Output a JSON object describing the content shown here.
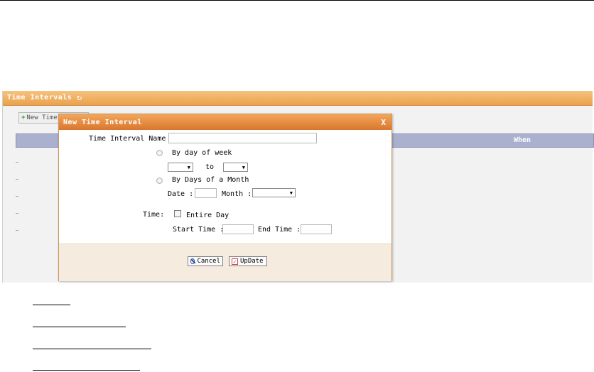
{
  "panel": {
    "title": "Time Intervals",
    "new_button_label": "New Time",
    "grid_column_when": "When"
  },
  "dialog": {
    "title": "New Time Interval",
    "close_label": "X",
    "name_label": "Time Interval Name :",
    "name_value": "",
    "by_day_of_week_label": "By day of week",
    "to_label": "to",
    "by_days_of_month_label": "By Days of a Month",
    "date_label": "Date :",
    "month_label": "Month :",
    "time_label": "Time:",
    "entire_day_label": "Entire Day",
    "start_time_label": "Start Time :",
    "end_time_label": "End Time :",
    "cancel_label": "Cancel",
    "update_label": "UpDate"
  },
  "icons": [
    "refresh-icon",
    "plus-icon",
    "close-icon",
    "cancel-icon",
    "check-icon"
  ],
  "colors": {
    "header_orange": "#e9a24e",
    "dialog_header": "#d9762e",
    "grid_header": "#a9b1cf",
    "footer_bg": "#f5ecdf"
  }
}
